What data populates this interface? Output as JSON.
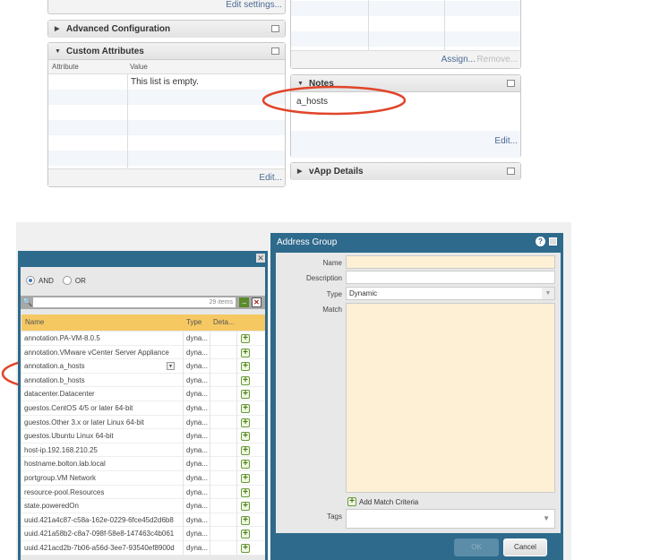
{
  "top": {
    "edit_settings": "Edit settings...",
    "advanced_configuration": "Advanced Configuration",
    "custom_attributes": {
      "title": "Custom Attributes",
      "columns": [
        "Attribute",
        "Value"
      ],
      "empty": "This list is empty.",
      "edit": "Edit..."
    },
    "tags_panel": {
      "assign": "Assign...",
      "remove": "Remove..."
    },
    "notes": {
      "title": "Notes",
      "text": "a_hosts",
      "edit": "Edit..."
    },
    "vapp_details": "vApp Details"
  },
  "match_dialog": {
    "and_label": "AND",
    "or_label": "OR",
    "and_selected": true,
    "item_count": "29 items",
    "columns": [
      "Name",
      "Type",
      "Deta..."
    ],
    "rows": [
      {
        "name": "annotation.PA-VM-8.0.5",
        "type": "dyna..."
      },
      {
        "name": "annotation.VMware vCenter Server Appliance",
        "type": "dyna..."
      },
      {
        "name": "annotation.a_hosts",
        "type": "dyna..."
      },
      {
        "name": "annotation.b_hosts",
        "type": "dyna..."
      },
      {
        "name": "datacenter.Datacenter",
        "type": "dyna..."
      },
      {
        "name": "guestos.CentOS 4/5 or later 64-bit",
        "type": "dyna..."
      },
      {
        "name": "guestos.Other 3.x or later Linux 64-bit",
        "type": "dyna..."
      },
      {
        "name": "guestos.Ubuntu Linux 64-bit",
        "type": "dyna..."
      },
      {
        "name": "host-ip.192.168.210.25",
        "type": "dyna..."
      },
      {
        "name": "hostname.bolton.lab.local",
        "type": "dyna..."
      },
      {
        "name": "portgroup.VM Network",
        "type": "dyna..."
      },
      {
        "name": "resource-pool.Resources",
        "type": "dyna..."
      },
      {
        "name": "state.poweredOn",
        "type": "dyna..."
      },
      {
        "name": "uuid.421a4c87-c58a-162e-0229-6fce45d2d6b8",
        "type": "dyna..."
      },
      {
        "name": "uuid.421a58b2-c8a7-098f-58e8-147463c4b061",
        "type": "dyna..."
      },
      {
        "name": "uuid.421acd2b-7b06-a56d-3ee7-93540ef8900d",
        "type": "dyna..."
      }
    ]
  },
  "address_group": {
    "title": "Address Group",
    "name_label": "Name",
    "description_label": "Description",
    "type_label": "Type",
    "type_value": "Dynamic",
    "match_label": "Match",
    "add_match": "Add Match Criteria",
    "tags_label": "Tags",
    "ok": "OK",
    "cancel": "Cancel"
  },
  "colors": {
    "dialog_header": "#2e6a8c",
    "table_header": "#f5c862",
    "required_field": "#fdf0d5",
    "annotation": "#e0452a"
  }
}
